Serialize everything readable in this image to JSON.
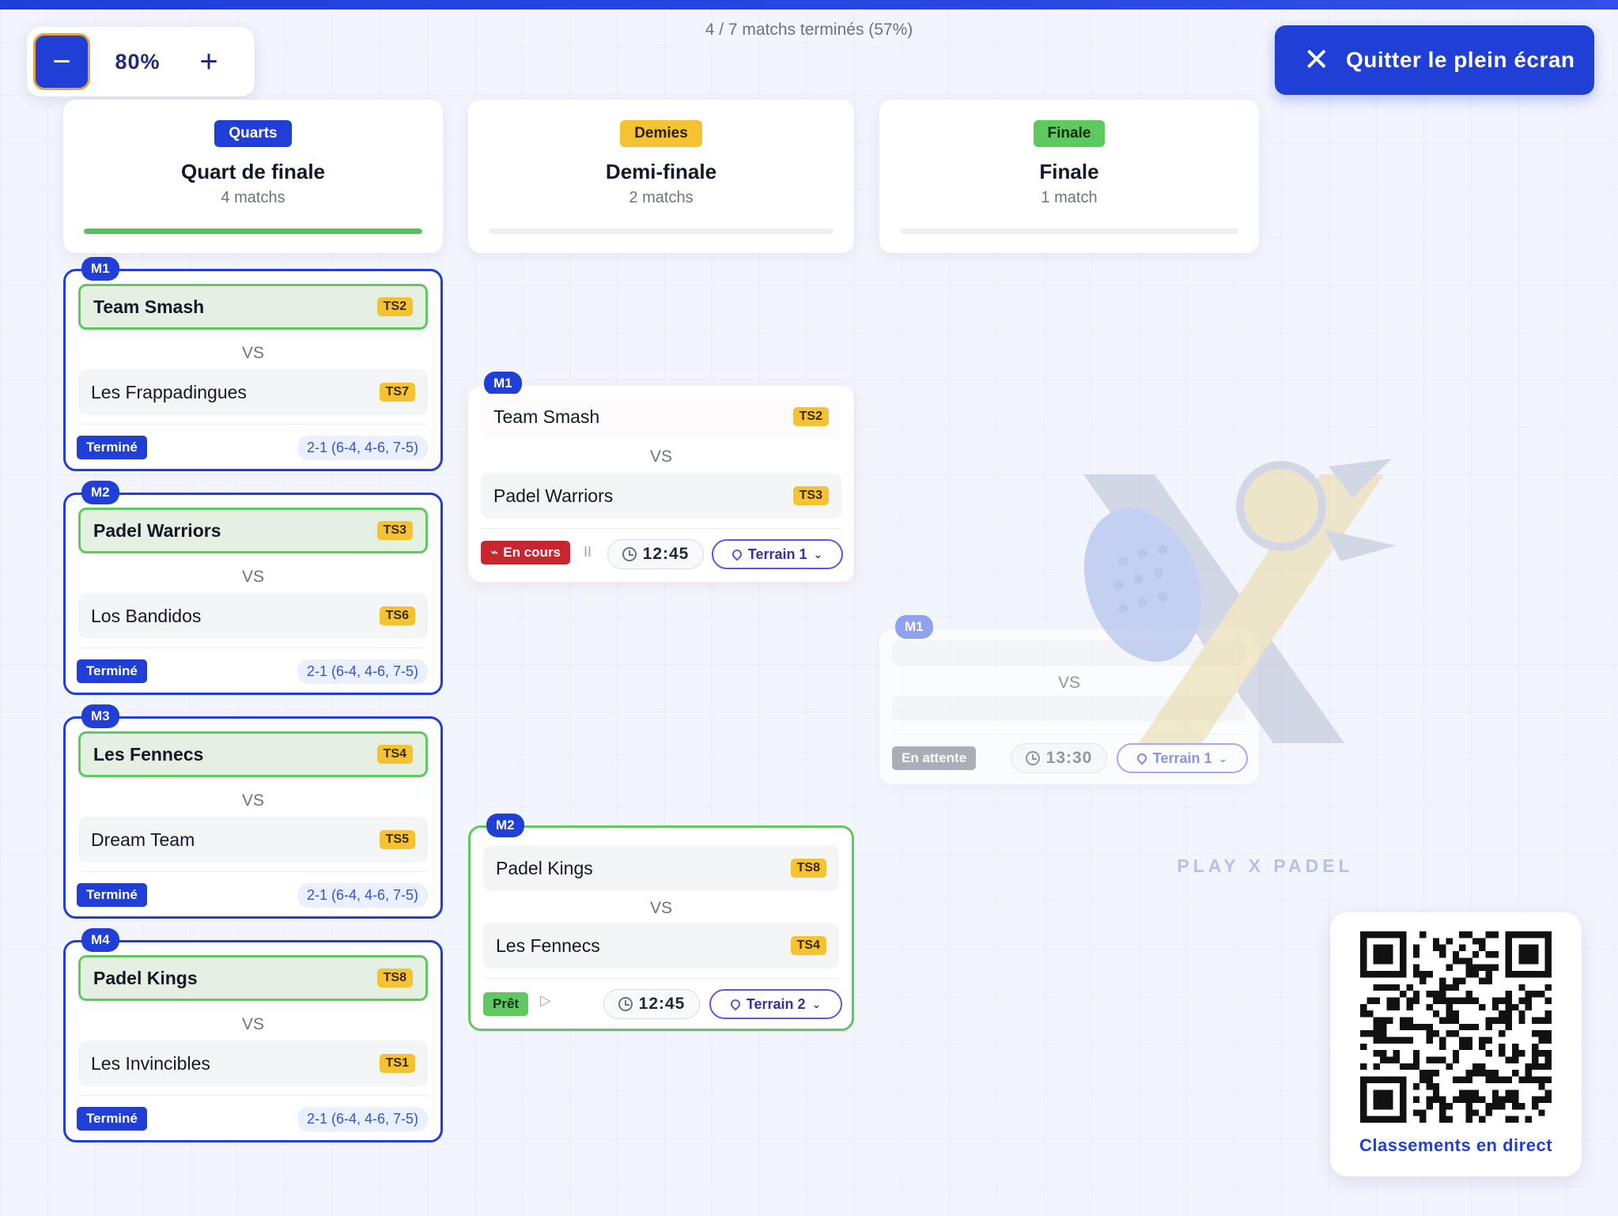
{
  "progress_text": "4 / 7 matchs terminés (57%)",
  "zoom": {
    "minus_icon": "minus-icon",
    "value": "80%",
    "plus_icon": "plus-icon"
  },
  "exit_button": {
    "label": "Quitter le plein écran",
    "icon": "close-icon"
  },
  "columns": [
    {
      "badge": "Quarts",
      "badge_color": "#1f3fd6",
      "title": "Quart de finale",
      "subtitle": "4 matchs",
      "progress": 1.0
    },
    {
      "badge": "Demies",
      "badge_color": "#f5c332",
      "title": "Demi-finale",
      "subtitle": "2 matchs",
      "progress": 0.0
    },
    {
      "badge": "Finale",
      "badge_color": "#5dc95e",
      "title": "Finale",
      "subtitle": "1 match",
      "progress": 0.0
    }
  ],
  "quarterfinals": [
    {
      "tag": "M1",
      "team1": "Team Smash",
      "seed1": "TS2",
      "vs": "VS",
      "team2": "Les Frappadingues",
      "seed2": "TS7",
      "status": "Terminé",
      "score": "2-1 (6-4, 4-6, 7-5)"
    },
    {
      "tag": "M2",
      "team1": "Padel Warriors",
      "seed1": "TS3",
      "vs": "VS",
      "team2": "Los Bandidos",
      "seed2": "TS6",
      "status": "Terminé",
      "score": "2-1 (6-4, 4-6, 7-5)"
    },
    {
      "tag": "M3",
      "team1": "Les Fennecs",
      "seed1": "TS4",
      "vs": "VS",
      "team2": "Dream Team",
      "seed2": "TS5",
      "status": "Terminé",
      "score": "2-1 (6-4, 4-6, 7-5)"
    },
    {
      "tag": "M4",
      "team1": "Padel Kings",
      "seed1": "TS8",
      "vs": "VS",
      "team2": "Les Invincibles",
      "seed2": "TS1",
      "status": "Terminé",
      "score": "2-1 (6-4, 4-6, 7-5)"
    }
  ],
  "semifinals": [
    {
      "tag": "M1",
      "team1": "Team Smash",
      "seed1": "TS2",
      "vs": "VS",
      "team2": "Padel Warriors",
      "seed2": "TS3",
      "status": "En cours",
      "status_icon": "activity-icon",
      "control_icon": "pause-icon",
      "time": "12:45",
      "court": "Terrain 1"
    },
    {
      "tag": "M2",
      "team1": "Padel Kings",
      "seed1": "TS8",
      "vs": "VS",
      "team2": "Les Fennecs",
      "seed2": "TS4",
      "status": "Prêt",
      "control_icon": "play-icon",
      "time": "12:45",
      "court": "Terrain 2"
    }
  ],
  "final": {
    "tag": "M1",
    "vs": "VS",
    "status": "En attente",
    "time": "13:30",
    "court": "Terrain 1"
  },
  "brand": "PLAY X PADEL",
  "qr": {
    "label": "Classements en direct",
    "icon": "qr-code-icon"
  }
}
